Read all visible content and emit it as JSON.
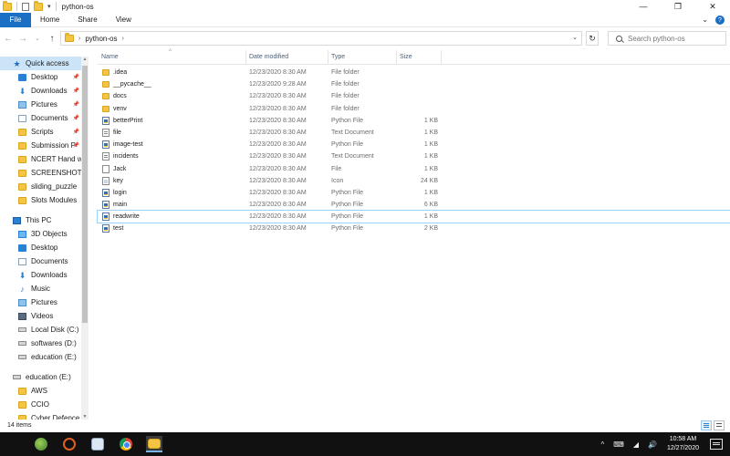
{
  "window": {
    "title": "python-os",
    "controls": {
      "minimize": "—",
      "maximize": "❐",
      "close": "✕"
    }
  },
  "ribbon": {
    "tabs": [
      "File",
      "Home",
      "Share",
      "View"
    ],
    "expand": "⌄",
    "help": "?"
  },
  "address": {
    "back": "←",
    "forward": "→",
    "recent": "⌄",
    "up": "↑",
    "path": [
      "python-os"
    ],
    "refresh": "↻",
    "search_placeholder": "Search python-os"
  },
  "sidebar": {
    "items": [
      {
        "label": "Quick access",
        "icon": "star-icon",
        "pinned": false,
        "selected": true,
        "indent": 0
      },
      {
        "label": "Desktop",
        "icon": "desktop-icon",
        "pinned": true,
        "indent": 1
      },
      {
        "label": "Downloads",
        "icon": "download-icon",
        "pinned": true,
        "indent": 1
      },
      {
        "label": "Pictures",
        "icon": "pictures-icon",
        "pinned": true,
        "indent": 1
      },
      {
        "label": "Documents",
        "icon": "documents-icon",
        "pinned": true,
        "indent": 1
      },
      {
        "label": "Scripts",
        "icon": "folder-icon",
        "pinned": true,
        "indent": 1
      },
      {
        "label": "Submission P",
        "icon": "folder-icon",
        "pinned": true,
        "indent": 1
      },
      {
        "label": "NCERT Hand wri",
        "icon": "folder-icon",
        "pinned": false,
        "indent": 1
      },
      {
        "label": "SCREENSHOTS",
        "icon": "folder-icon",
        "pinned": false,
        "indent": 1
      },
      {
        "label": "sliding_puzzle",
        "icon": "folder-icon",
        "pinned": false,
        "indent": 1
      },
      {
        "label": "Slots Modules",
        "icon": "folder-icon",
        "pinned": false,
        "indent": 1
      },
      {
        "label": "",
        "icon": "",
        "spacer": true
      },
      {
        "label": "This PC",
        "icon": "pc-icon",
        "pinned": false,
        "indent": 0
      },
      {
        "label": "3D Objects",
        "icon": "3d-objects-icon",
        "pinned": false,
        "indent": 1
      },
      {
        "label": "Desktop",
        "icon": "desktop-icon",
        "pinned": false,
        "indent": 1
      },
      {
        "label": "Documents",
        "icon": "documents-icon",
        "pinned": false,
        "indent": 1
      },
      {
        "label": "Downloads",
        "icon": "download-icon",
        "pinned": false,
        "indent": 1
      },
      {
        "label": "Music",
        "icon": "music-icon",
        "pinned": false,
        "indent": 1
      },
      {
        "label": "Pictures",
        "icon": "pictures-icon",
        "pinned": false,
        "indent": 1
      },
      {
        "label": "Videos",
        "icon": "videos-icon",
        "pinned": false,
        "indent": 1
      },
      {
        "label": "Local Disk (C:)",
        "icon": "drive-icon",
        "pinned": false,
        "indent": 1
      },
      {
        "label": "softwares (D:)",
        "icon": "drive-icon",
        "pinned": false,
        "indent": 1
      },
      {
        "label": "education (E:)",
        "icon": "drive-icon",
        "pinned": false,
        "indent": 1
      },
      {
        "label": "",
        "icon": "",
        "spacer": true
      },
      {
        "label": "education (E:)",
        "icon": "drive-icon",
        "pinned": false,
        "indent": 0
      },
      {
        "label": "AWS",
        "icon": "folder-icon",
        "pinned": false,
        "indent": 1
      },
      {
        "label": "CCIO",
        "icon": "folder-icon",
        "pinned": false,
        "indent": 1
      },
      {
        "label": "Cyber Defence",
        "icon": "folder-icon",
        "pinned": false,
        "indent": 1
      }
    ]
  },
  "columns": {
    "name": "Name",
    "date": "Date modified",
    "type": "Type",
    "size": "Size"
  },
  "files": [
    {
      "name": ".idea",
      "date": "12/23/2020 8:30 AM",
      "type": "File folder",
      "size": "",
      "icon": "folder"
    },
    {
      "name": "__pycache__",
      "date": "12/23/2020 9:28 AM",
      "type": "File folder",
      "size": "",
      "icon": "folder"
    },
    {
      "name": "docs",
      "date": "12/23/2020 8:30 AM",
      "type": "File folder",
      "size": "",
      "icon": "folder"
    },
    {
      "name": "venv",
      "date": "12/23/2020 8:30 AM",
      "type": "File folder",
      "size": "",
      "icon": "folder"
    },
    {
      "name": "betterPrint",
      "date": "12/23/2020 8:30 AM",
      "type": "Python File",
      "size": "1 KB",
      "icon": "py"
    },
    {
      "name": "file",
      "date": "12/23/2020 8:30 AM",
      "type": "Text Document",
      "size": "1 KB",
      "icon": "txt"
    },
    {
      "name": "image-test",
      "date": "12/23/2020 8:30 AM",
      "type": "Python File",
      "size": "1 KB",
      "icon": "py"
    },
    {
      "name": "incidents",
      "date": "12/23/2020 8:30 AM",
      "type": "Text Document",
      "size": "1 KB",
      "icon": "txt"
    },
    {
      "name": "Jack",
      "date": "12/23/2020 8:30 AM",
      "type": "File",
      "size": "1 KB",
      "icon": "blank"
    },
    {
      "name": "key",
      "date": "12/23/2020 8:30 AM",
      "type": "Icon",
      "size": "24 KB",
      "icon": "icon"
    },
    {
      "name": "login",
      "date": "12/23/2020 8:30 AM",
      "type": "Python File",
      "size": "1 KB",
      "icon": "py"
    },
    {
      "name": "main",
      "date": "12/23/2020 8:30 AM",
      "type": "Python File",
      "size": "6 KB",
      "icon": "py"
    },
    {
      "name": "readwrite",
      "date": "12/23/2020 8:30 AM",
      "type": "Python File",
      "size": "1 KB",
      "icon": "py",
      "hover": true
    },
    {
      "name": "test",
      "date": "12/23/2020 8:30 AM",
      "type": "Python File",
      "size": "2 KB",
      "icon": "py"
    }
  ],
  "status": {
    "count": "14 items"
  },
  "taskbar": {
    "time": "10:58 AM",
    "date": "12/27/2020",
    "tray": [
      "^",
      "⌨",
      "◢",
      "🔊"
    ]
  }
}
